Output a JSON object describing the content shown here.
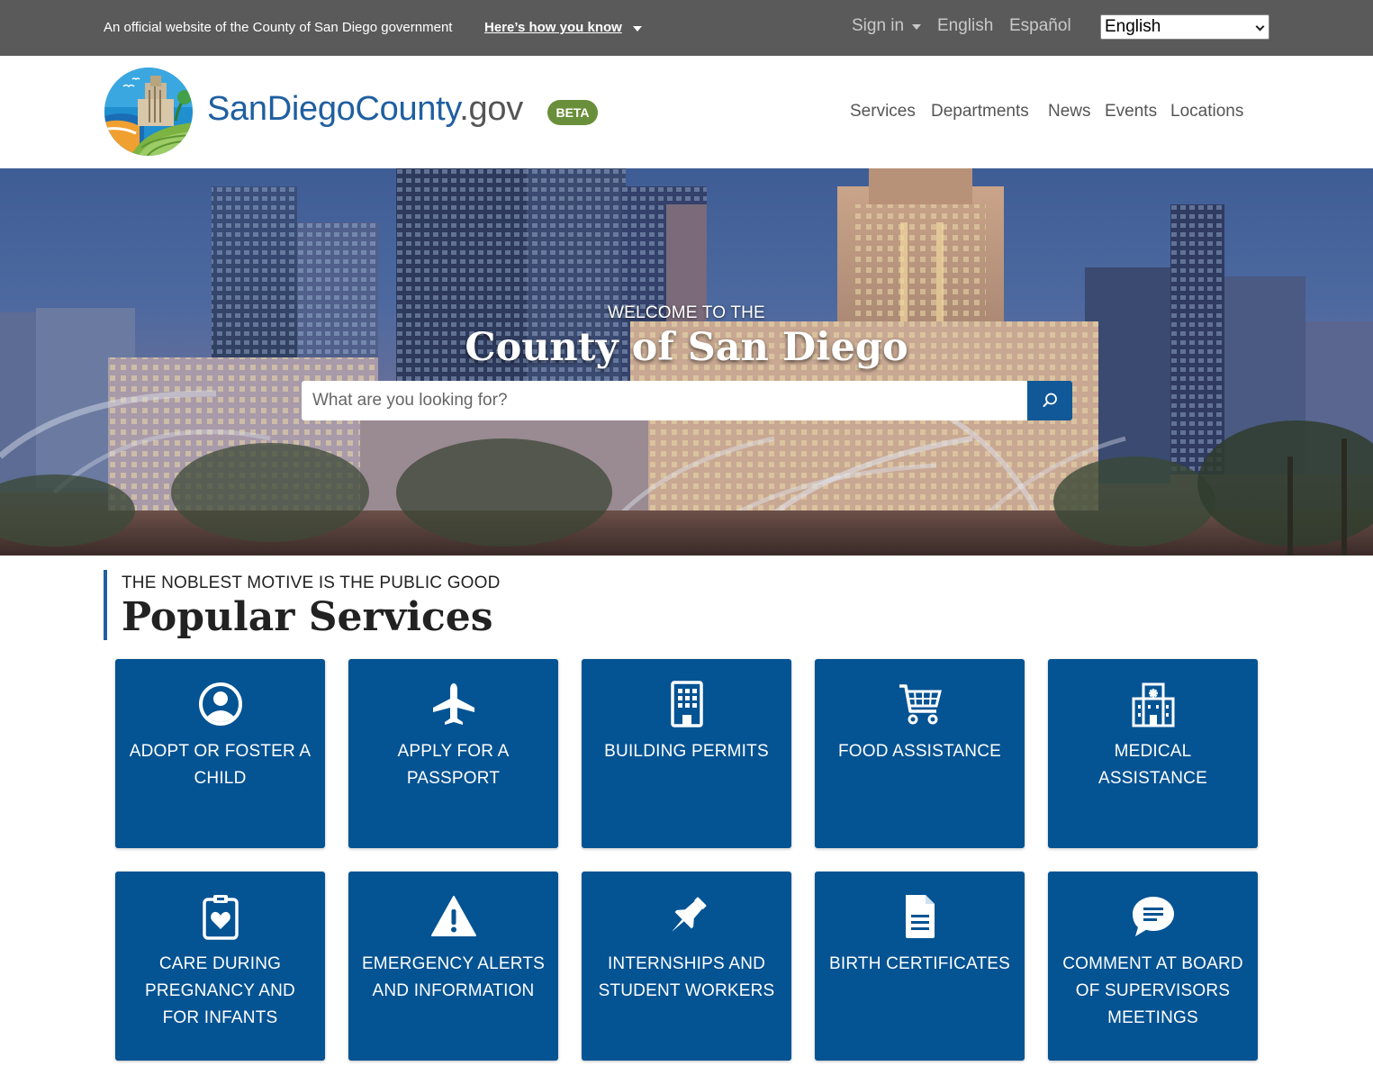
{
  "gov_bar": {
    "official_text": "An official website of the County of San Diego government",
    "how_you_know": "Here’s how you know",
    "sign_in": "Sign in",
    "lang_english": "English",
    "lang_spanish": "Español",
    "language_select_value": "English"
  },
  "header": {
    "brand_main": "SanDiegoCounty",
    "brand_tld": ".gov",
    "badge": "BETA",
    "nav": [
      "Services",
      "Departments",
      "News",
      "Events",
      "Locations"
    ]
  },
  "hero": {
    "eyebrow": "WELCOME TO THE",
    "title": "County of San Diego",
    "search_placeholder": "What are you looking for?"
  },
  "popular": {
    "eyebrow": "THE NOBLEST MOTIVE IS THE PUBLIC GOOD",
    "title": "Popular Services",
    "tiles": [
      {
        "label": "Adopt or foster a child",
        "icon": "user-circle-icon"
      },
      {
        "label": "Apply for a passport",
        "icon": "plane-icon"
      },
      {
        "label": "Building permits",
        "icon": "building-icon"
      },
      {
        "label": "Food assistance",
        "icon": "shopping-cart-icon"
      },
      {
        "label": "Medical assistance",
        "icon": "hospital-icon"
      },
      {
        "label": "Care during pregnancy and for infants",
        "icon": "clipboard-heart-icon"
      },
      {
        "label": "Emergency alerts and information",
        "icon": "warning-icon"
      },
      {
        "label": "Internships and student workers",
        "icon": "pushpin-icon"
      },
      {
        "label": "Birth certificates",
        "icon": "document-icon"
      },
      {
        "label": "Comment at board of supervisors meetings",
        "icon": "chat-bubble-icon"
      }
    ]
  },
  "colors": {
    "gov_bar": "#5a5a5a",
    "brand_blue": "#1f5fa0",
    "beta_green": "#6a8f3a",
    "tile_blue": "#045393",
    "search_button": "#105897"
  }
}
